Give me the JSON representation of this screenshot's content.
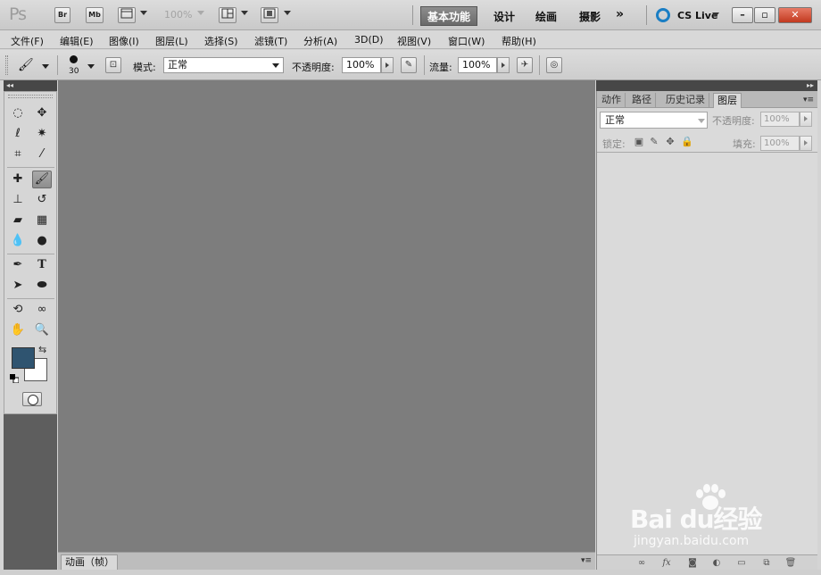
{
  "titlebar": {
    "app_logo": "Ps",
    "br_label": "Br",
    "mb_label": "Mb",
    "zoom": "100%",
    "workspaces": [
      "基本功能",
      "设计",
      "绘画",
      "摄影"
    ],
    "more": "»",
    "cs_live": "CS Live",
    "win_min": "–",
    "win_restore": "▫",
    "win_close": "✕"
  },
  "menu": [
    "文件(F)",
    "编辑(E)",
    "图像(I)",
    "图层(L)",
    "选择(S)",
    "滤镜(T)",
    "分析(A)",
    "3D(D)",
    "视图(V)",
    "窗口(W)",
    "帮助(H)"
  ],
  "options": {
    "brush_size": "30",
    "mode_label": "模式:",
    "mode_value": "正常",
    "opacity_label": "不透明度:",
    "opacity_value": "100%",
    "flow_label": "流量:",
    "flow_value": "100%"
  },
  "left_strip": "◂◂",
  "tools": {
    "colors": {
      "foreground": "#2f5470",
      "background": "#ffffff"
    }
  },
  "animation_panel": {
    "tab": "动画（帧）",
    "menu": "▾≡"
  },
  "right_panel": {
    "strip": "▸▸",
    "tabs": [
      "动作",
      "路径",
      "历史记录",
      "图层"
    ],
    "menu": "▾≡",
    "blend_mode": "正常",
    "opacity_label": "不透明度:",
    "opacity_value": "100%",
    "lock_label": "锁定:",
    "fill_label": "填充:",
    "fill_value": "100%",
    "footer_fx": "fx"
  },
  "watermark": {
    "main": "Bai du经验",
    "sub": "jingyan.baidu.com"
  }
}
